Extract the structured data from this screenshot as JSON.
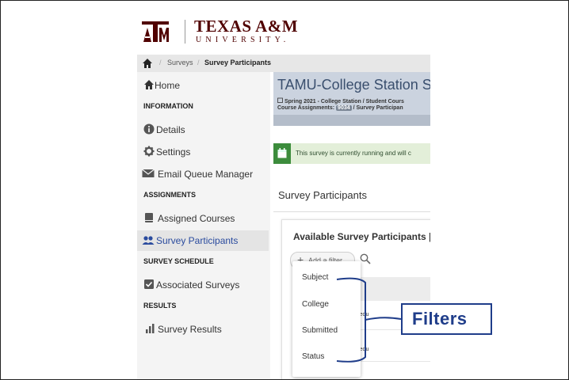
{
  "logo": {
    "mark": "ATM",
    "name": "TEXAS A&M",
    "subtitle": "UNIVERSITY."
  },
  "breadcrumb": {
    "items": [
      "Surveys",
      "Survey Participants"
    ]
  },
  "sidebar": {
    "home": "Home",
    "sections": {
      "information": "INFORMATION",
      "assignments": "ASSIGNMENTS",
      "survey_schedule": "SURVEY SCHEDULE",
      "results": "RESULTS"
    },
    "items": {
      "details": "Details",
      "settings": "Settings",
      "email_queue": "Email Queue Manager",
      "assigned_courses": "Assigned Courses",
      "survey_participants": "Survey Participants",
      "associated_surveys": "Associated Surveys",
      "survey_results": "Survey Results"
    }
  },
  "banner": {
    "title": "TAMU-College Station St",
    "sub1": "Spring 2021 - College Station / Student Cours",
    "sub2_prefix": "Course Assignments:",
    "count": "9034",
    "sub2_suffix": "/ Survey Participan"
  },
  "notice": {
    "text": "This survey is currently running and will c"
  },
  "section": {
    "title": "Survey Participants"
  },
  "card": {
    "title": "Available Survey Participants |",
    "add_filter": "Add a filter",
    "emails": [
      "mu.edu",
      "mu.edu"
    ]
  },
  "filter_menu": {
    "options": [
      "Subject",
      "College",
      "Submitted",
      "Status"
    ]
  },
  "annotation": {
    "label": "Filters",
    "color": "#1f3d8a"
  },
  "colors": {
    "maroon": "#500000",
    "active_link": "#2a4b9e",
    "notice_green": "#3c8c3c"
  }
}
